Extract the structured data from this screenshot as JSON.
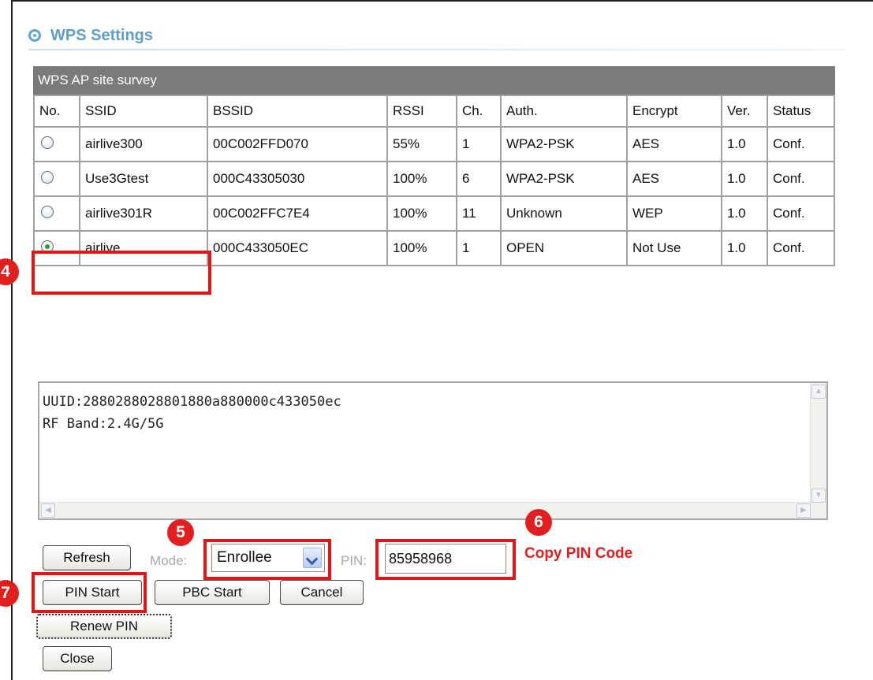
{
  "header": {
    "title": "WPS Settings"
  },
  "survey": {
    "title": "WPS AP site survey",
    "columns": [
      "No.",
      "SSID",
      "BSSID",
      "RSSI",
      "Ch.",
      "Auth.",
      "Encrypt",
      "Ver.",
      "Status"
    ],
    "rows": [
      {
        "ssid": "airlive300",
        "bssid": "00C002FFD070",
        "rssi": "55%",
        "ch": "1",
        "auth": "WPA2-PSK",
        "encrypt": "AES",
        "ver": "1.0",
        "status": "Conf.",
        "selected": false
      },
      {
        "ssid": "Use3Gtest",
        "bssid": "000C43305030",
        "rssi": "100%",
        "ch": "6",
        "auth": "WPA2-PSK",
        "encrypt": "AES",
        "ver": "1.0",
        "status": "Conf.",
        "selected": false
      },
      {
        "ssid": "airlive301R",
        "bssid": "00C002FFC7E4",
        "rssi": "100%",
        "ch": "11",
        "auth": "Unknown",
        "encrypt": "WEP",
        "ver": "1.0",
        "status": "Conf.",
        "selected": false
      },
      {
        "ssid": "airlive",
        "bssid": "000C433050EC",
        "rssi": "100%",
        "ch": "1",
        "auth": "OPEN",
        "encrypt": "Not Use",
        "ver": "1.0",
        "status": "Conf.",
        "selected": true
      }
    ]
  },
  "info": {
    "lines": [
      "UUID:2880288028801880a880000c433050ec",
      "RF Band:2.4G/5G"
    ]
  },
  "controls": {
    "refresh_label": "Refresh",
    "mode_label": "Mode:",
    "mode_value": "Enrollee",
    "pin_label": "PIN:",
    "pin_value": "85958968",
    "pin_start_label": "PIN Start",
    "pbc_start_label": "PBC Start",
    "cancel_label": "Cancel",
    "renew_pin_label": "Renew PIN",
    "close_label": "Close"
  },
  "annotations": {
    "step4": "4",
    "step5": "5",
    "step6": "6",
    "step7": "7",
    "copy_pin": "Copy PIN Code"
  },
  "colors": {
    "highlight": "#e11717",
    "title": "#5f9ec6",
    "survey_bar": "#7b7b7b"
  }
}
